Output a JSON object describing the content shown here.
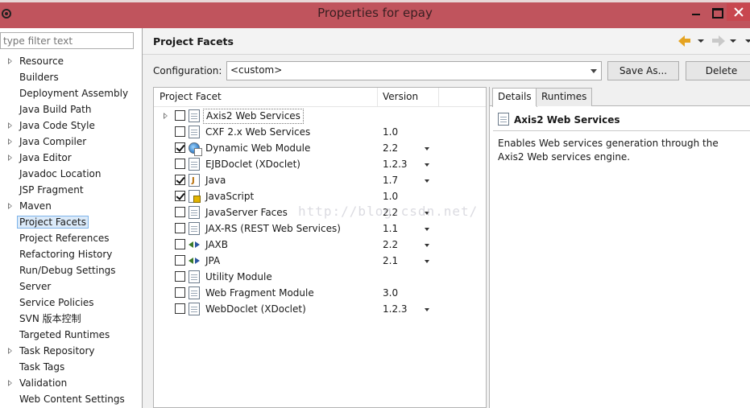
{
  "window": {
    "title": "Properties for epay"
  },
  "filter": {
    "placeholder": "type filter text"
  },
  "sidebar": {
    "items": [
      {
        "label": "Resource",
        "expandable": true
      },
      {
        "label": "Builders",
        "expandable": false
      },
      {
        "label": "Deployment Assembly",
        "expandable": false
      },
      {
        "label": "Java Build Path",
        "expandable": false
      },
      {
        "label": "Java Code Style",
        "expandable": true
      },
      {
        "label": "Java Compiler",
        "expandable": true
      },
      {
        "label": "Java Editor",
        "expandable": true
      },
      {
        "label": "Javadoc Location",
        "expandable": false
      },
      {
        "label": "JSP Fragment",
        "expandable": false
      },
      {
        "label": "Maven",
        "expandable": true
      },
      {
        "label": "Project Facets",
        "expandable": false,
        "selected": true
      },
      {
        "label": "Project References",
        "expandable": false
      },
      {
        "label": "Refactoring History",
        "expandable": false
      },
      {
        "label": "Run/Debug Settings",
        "expandable": false
      },
      {
        "label": "Server",
        "expandable": false
      },
      {
        "label": "Service Policies",
        "expandable": false
      },
      {
        "label": "SVN 版本控制",
        "expandable": false
      },
      {
        "label": "Targeted Runtimes",
        "expandable": false
      },
      {
        "label": "Task Repository",
        "expandable": true
      },
      {
        "label": "Task Tags",
        "expandable": false
      },
      {
        "label": "Validation",
        "expandable": true
      },
      {
        "label": "Web Content Settings",
        "expandable": false
      }
    ]
  },
  "page": {
    "title": "Project Facets"
  },
  "config": {
    "label": "Configuration:",
    "value": "<custom>",
    "save_as": "Save As...",
    "delete": "Delete"
  },
  "table": {
    "col_facet": "Project Facet",
    "col_version": "Version",
    "rows": [
      {
        "name": "Axis2 Web Services",
        "version": "",
        "checked": false,
        "icon": "doc",
        "expandable": true,
        "selected": true,
        "dropdown": false
      },
      {
        "name": "CXF 2.x Web Services",
        "version": "1.0",
        "checked": false,
        "icon": "doc",
        "dropdown": false
      },
      {
        "name": "Dynamic Web Module",
        "version": "2.2",
        "checked": true,
        "icon": "globe",
        "dropdown": true
      },
      {
        "name": "EJBDoclet (XDoclet)",
        "version": "1.2.3",
        "checked": false,
        "icon": "doc",
        "dropdown": true
      },
      {
        "name": "Java",
        "version": "1.7",
        "checked": true,
        "icon": "java",
        "dropdown": true
      },
      {
        "name": "JavaScript",
        "version": "1.0",
        "checked": true,
        "icon": "js",
        "dropdown": false
      },
      {
        "name": "JavaServer Faces",
        "version": "2.2",
        "checked": false,
        "icon": "doc",
        "dropdown": true
      },
      {
        "name": "JAX-RS (REST Web Services)",
        "version": "1.1",
        "checked": false,
        "icon": "doc",
        "dropdown": true
      },
      {
        "name": "JAXB",
        "version": "2.2",
        "checked": false,
        "icon": "arrows",
        "dropdown": true
      },
      {
        "name": "JPA",
        "version": "2.1",
        "checked": false,
        "icon": "arrows",
        "dropdown": true
      },
      {
        "name": "Utility Module",
        "version": "",
        "checked": false,
        "icon": "doc",
        "dropdown": false
      },
      {
        "name": "Web Fragment Module",
        "version": "3.0",
        "checked": false,
        "icon": "doc",
        "dropdown": false
      },
      {
        "name": "WebDoclet (XDoclet)",
        "version": "1.2.3",
        "checked": false,
        "icon": "doc",
        "dropdown": true
      }
    ]
  },
  "details": {
    "tab_details": "Details",
    "tab_runtimes": "Runtimes",
    "title": "Axis2 Web Services",
    "description": "Enables Web services generation through the Axis2 Web services engine."
  },
  "watermark": "http://blog.csdn.net/",
  "colors": {
    "titlebar": "#c0545d",
    "selection": "#dbeaf9",
    "nav_back": "#e5a321"
  }
}
